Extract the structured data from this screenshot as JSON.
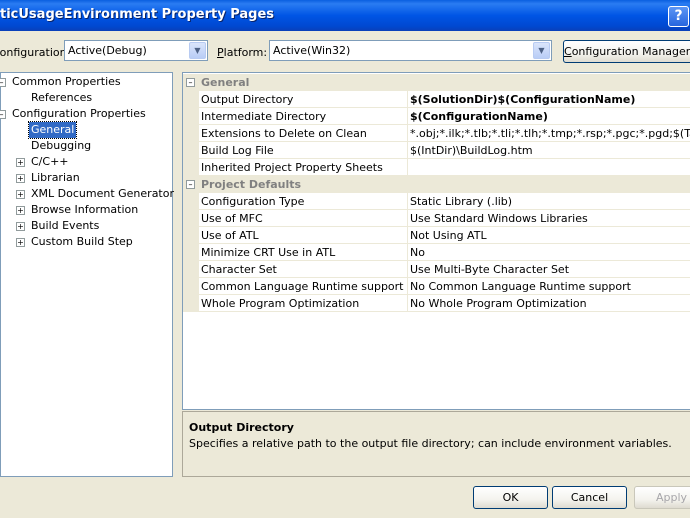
{
  "window": {
    "title": "ticUsageEnvironment Property Pages",
    "help_label": "?"
  },
  "toolbar": {
    "configuration_label": "Configuration:",
    "configuration_value": "Active(Debug)",
    "platform_label_prefix": "P",
    "platform_label_rest": "latform:",
    "platform_value": "Active(Win32)",
    "config_manager_prefix": "C",
    "config_manager_rest": "onfiguration Manager..."
  },
  "tree": {
    "common": {
      "label": "Common Properties",
      "children": [
        "References"
      ]
    },
    "configuration": {
      "label": "Configuration Properties",
      "children": [
        {
          "label": "General",
          "selected": true,
          "expandable": false
        },
        {
          "label": "Debugging",
          "expandable": false
        },
        {
          "label": "C/C++",
          "expandable": true
        },
        {
          "label": "Librarian",
          "expandable": true
        },
        {
          "label": "XML Document Generator",
          "expandable": true
        },
        {
          "label": "Browse Information",
          "expandable": true
        },
        {
          "label": "Build Events",
          "expandable": true
        },
        {
          "label": "Custom Build Step",
          "expandable": true
        }
      ]
    }
  },
  "grid": {
    "general": {
      "label": "General",
      "rows": [
        {
          "name": "Output Directory",
          "value": "$(SolutionDir)$(ConfigurationName)",
          "bold": true
        },
        {
          "name": "Intermediate Directory",
          "value": "$(ConfigurationName)",
          "bold": true
        },
        {
          "name": "Extensions to Delete on Clean",
          "value": "*.obj;*.ilk;*.tlb;*.tli;*.tlh;*.tmp;*.rsp;*.pgc;*.pgd;$(Targ"
        },
        {
          "name": "Build Log File",
          "value": "$(IntDir)\\BuildLog.htm"
        },
        {
          "name": "Inherited Project Property Sheets",
          "value": ""
        }
      ]
    },
    "defaults": {
      "label": "Project Defaults",
      "rows": [
        {
          "name": "Configuration Type",
          "value": "Static Library (.lib)"
        },
        {
          "name": "Use of MFC",
          "value": "Use Standard Windows Libraries"
        },
        {
          "name": "Use of ATL",
          "value": "Not Using ATL"
        },
        {
          "name": "Minimize CRT Use in ATL",
          "value": "No"
        },
        {
          "name": "Character Set",
          "value": "Use Multi-Byte Character Set"
        },
        {
          "name": "Common Language Runtime support",
          "value": "No Common Language Runtime support"
        },
        {
          "name": "Whole Program Optimization",
          "value": "No Whole Program Optimization"
        }
      ]
    }
  },
  "description": {
    "title": "Output Directory",
    "text": "Specifies a relative path to the output file directory; can include environment variables."
  },
  "buttons": {
    "ok": "OK",
    "cancel": "Cancel",
    "apply": "Apply"
  }
}
